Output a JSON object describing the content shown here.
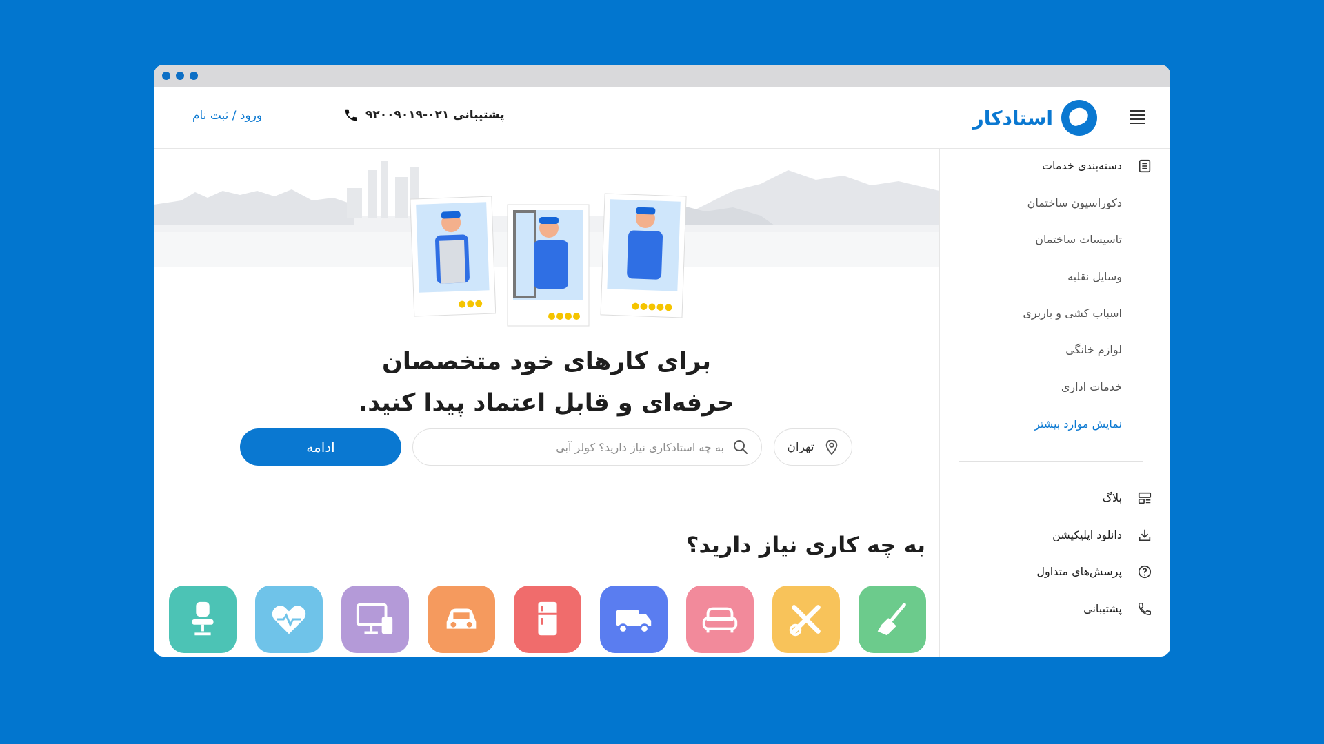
{
  "header": {
    "logo_text": "استادکار",
    "support_text": "پشتیبانی ۰۲۱-۹۲۰۰۹۰۱۹",
    "login_text": "ورود / ثبت نام"
  },
  "hero": {
    "line1": "برای کارهای خود متخصصان",
    "line2": "حرفه‌ای و قابل اعتماد پیدا کنید."
  },
  "search": {
    "city": "تهران",
    "placeholder": "به چه استادکاری نیاز دارید؟ کولر آبی",
    "continue_label": "ادامه"
  },
  "section_title": "به چه کاری نیاز دارید؟",
  "categories": [
    {
      "icon": "broom-icon",
      "color": "#6ccb8c"
    },
    {
      "icon": "tools-icon",
      "color": "#f8c35a"
    },
    {
      "icon": "sofa-icon",
      "color": "#f28a9b"
    },
    {
      "icon": "truck-icon",
      "color": "#5a7df0"
    },
    {
      "icon": "fridge-icon",
      "color": "#f06c6c"
    },
    {
      "icon": "car-icon",
      "color": "#f59a5e"
    },
    {
      "icon": "computer-icon",
      "color": "#b49ad8"
    },
    {
      "icon": "heart-pulse-icon",
      "color": "#6fc3e9"
    },
    {
      "icon": "chair-icon",
      "color": "#4cc3b5"
    }
  ],
  "sidebar": {
    "heading": "دسته‌بندی خدمات",
    "items": [
      "دکوراسیون ساختمان",
      "تاسیسات ساختمان",
      "وسایل نقلیه",
      "اسباب کشی و باربری",
      "لوازم خانگی",
      "خدمات اداری"
    ],
    "more_link": "نمایش موارد بیشتر",
    "bottom": [
      {
        "label": "بلاگ",
        "icon": "blog-icon"
      },
      {
        "label": "دانلود اپلیکیشن",
        "icon": "download-icon"
      },
      {
        "label": "پرسش‌های متداول",
        "icon": "question-icon"
      },
      {
        "label": "پشتیبانی",
        "icon": "phone-icon"
      }
    ]
  },
  "colors": {
    "background": "#0276cf",
    "accent": "#0a78d1"
  }
}
